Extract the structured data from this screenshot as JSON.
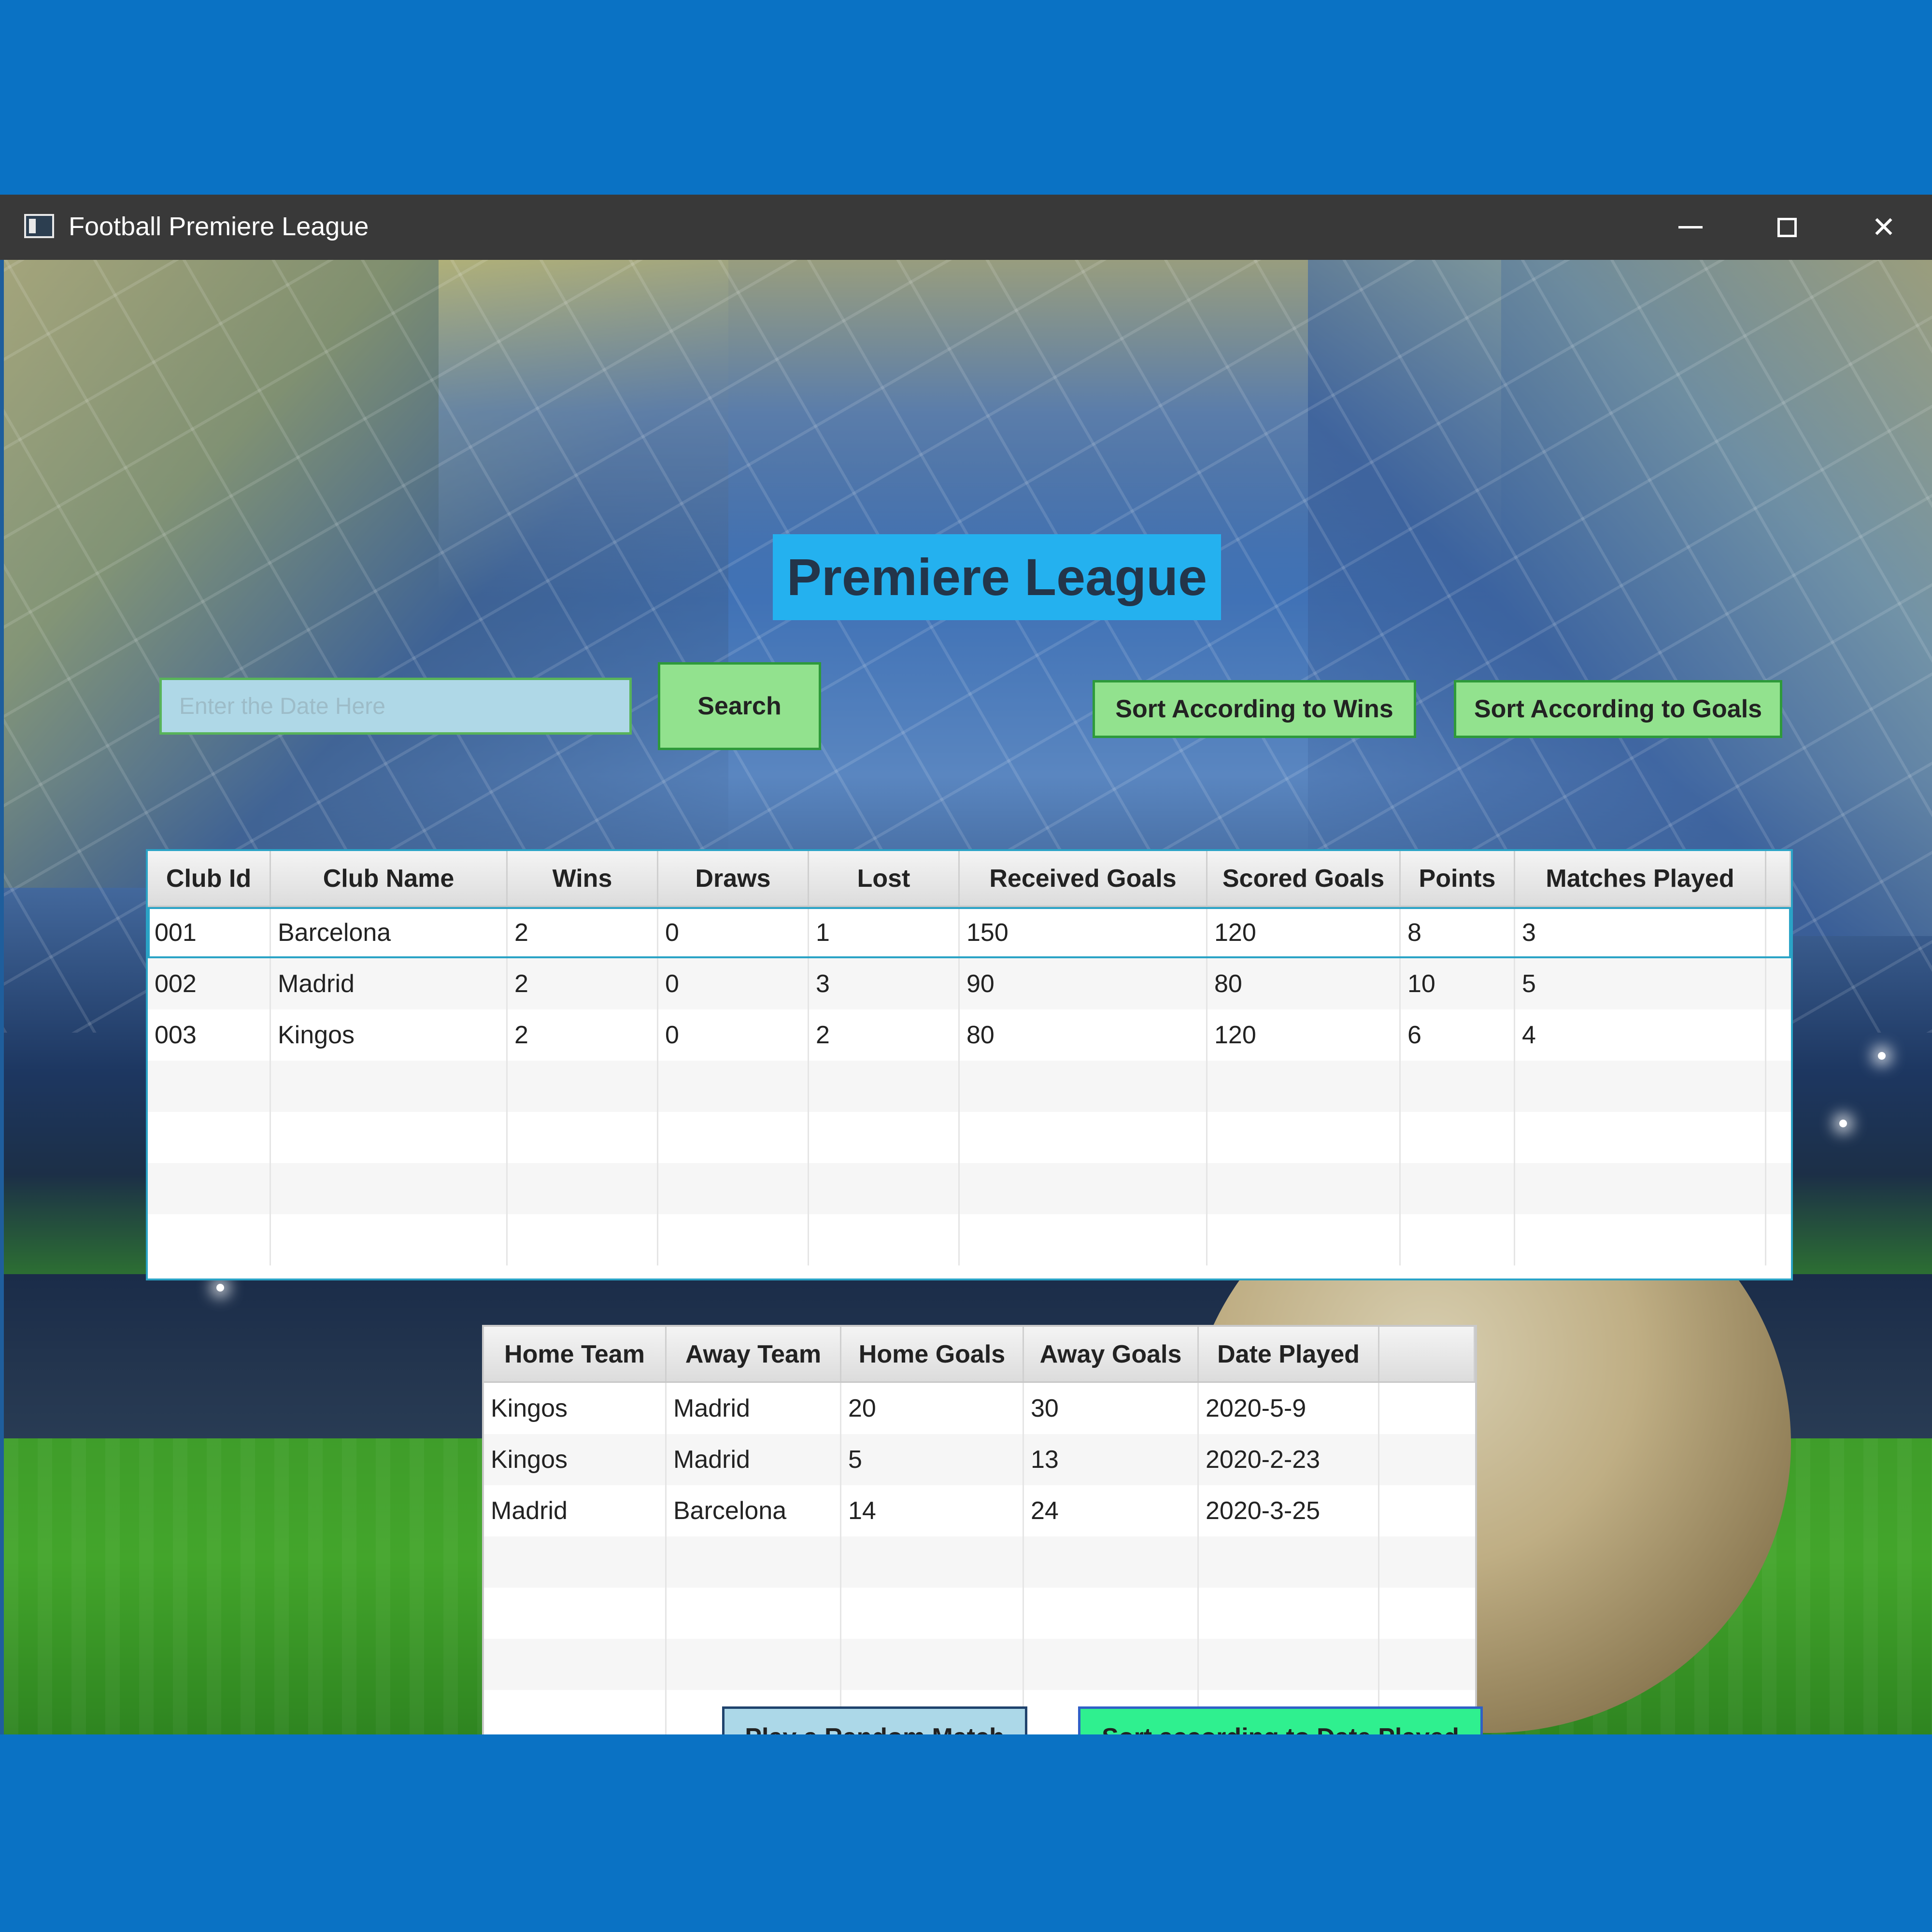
{
  "window": {
    "title": "Football Premiere League"
  },
  "header": {
    "title": "Premiere League"
  },
  "search": {
    "placeholder": "Enter the Date Here",
    "button_label": "Search"
  },
  "sort_buttons": {
    "wins_label": "Sort According to Wins",
    "goals_label": "Sort According to Goals"
  },
  "clubs_table": {
    "headers": [
      "Club Id",
      "Club Name",
      "Wins",
      "Draws",
      "Lost",
      "Received Goals",
      "Scored Goals",
      "Points",
      "Matches Played"
    ],
    "rows": [
      [
        "001",
        "Barcelona",
        "2",
        "0",
        "1",
        "150",
        "120",
        "8",
        "3"
      ],
      [
        "002",
        "Madrid",
        "2",
        "0",
        "3",
        "90",
        "80",
        "10",
        "5"
      ],
      [
        "003",
        "Kingos",
        "2",
        "0",
        "2",
        "80",
        "120",
        "6",
        "4"
      ]
    ]
  },
  "matches_table": {
    "headers": [
      "Home Team",
      "Away Team",
      "Home Goals",
      "Away Goals",
      "Date Played"
    ],
    "rows": [
      [
        "Kingos",
        "Madrid",
        "20",
        "30",
        "2020-5-9"
      ],
      [
        "Kingos",
        "Madrid",
        "5",
        "13",
        "2020-2-23"
      ],
      [
        "Madrid",
        "Barcelona",
        "14",
        "24",
        "2020-3-25"
      ]
    ]
  },
  "bottom_buttons": {
    "random_match_label": "Play a Random Match",
    "sort_date_label": "Sort according to Date Played"
  }
}
